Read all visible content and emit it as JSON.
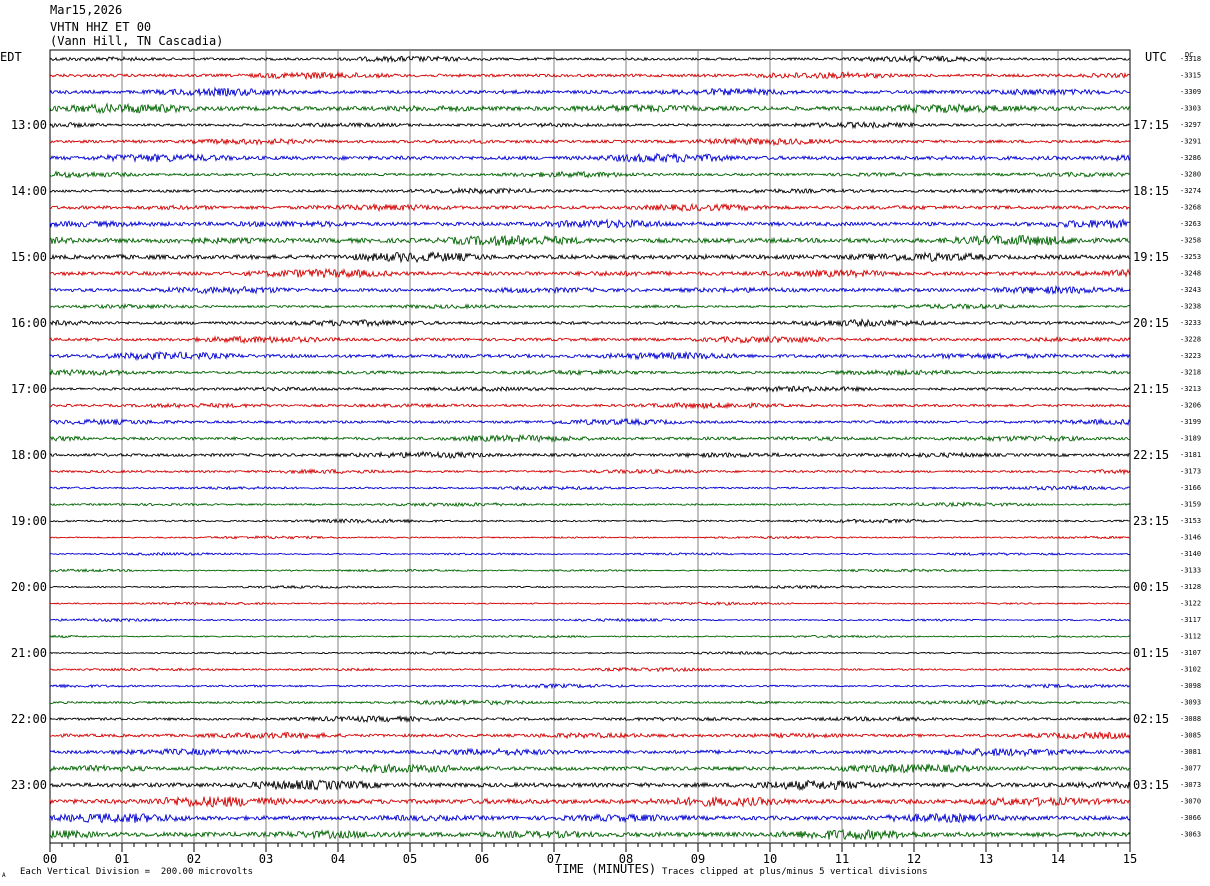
{
  "header": {
    "date": "Mar15,2026",
    "station": "VHTN HHZ ET 00",
    "location": "(Vann Hill, TN Cascadia)"
  },
  "left_zone_label": "EDT",
  "right_zone_label": "UTC",
  "dc_label": "DC",
  "footer": {
    "scale_note": "Each Vertical Division =  200.00 microvolts",
    "clip_note": "Traces clipped at plus/minus 5 vertical divisions",
    "corner_mark": "A"
  },
  "colors": {
    "trace_cycle": [
      "#000000",
      "#d40000",
      "#0000d4",
      "#006400"
    ],
    "grid": "#808080"
  },
  "chart_data": {
    "type": "line",
    "title": "",
    "xlabel": "TIME (MINUTES)",
    "ylabel": "",
    "xlim": [
      0,
      15
    ],
    "x_ticks": [
      "00",
      "01",
      "02",
      "03",
      "04",
      "05",
      "06",
      "07",
      "08",
      "09",
      "10",
      "11",
      "12",
      "13",
      "14",
      "15"
    ],
    "row_count": 48,
    "rows_per_hour": 4,
    "left_hour_labels": [
      "13:00",
      "14:00",
      "15:00",
      "16:00",
      "17:00",
      "18:00",
      "19:00",
      "20:00",
      "21:00",
      "22:00",
      "23:00"
    ],
    "right_hour_labels": [
      "17:15",
      "18:15",
      "19:15",
      "20:15",
      "21:15",
      "22:15",
      "23:15",
      "00:15",
      "01:15",
      "02:15",
      "03:15"
    ],
    "dc_offsets": [
      "-3318",
      "-3315",
      "-3309",
      "-3303",
      "-3297",
      "-3291",
      "-3286",
      "-3280",
      "-3274",
      "-3268",
      "-3263",
      "-3258",
      "-3253",
      "-3248",
      "-3243",
      "-3238",
      "-3233",
      "-3228",
      "-3223",
      "-3218",
      "-3213",
      "-3206",
      "-3199",
      "-3189",
      "-3181",
      "-3173",
      "-3166",
      "-3159",
      "-3153",
      "-3146",
      "-3140",
      "-3133",
      "-3128",
      "-3122",
      "-3117",
      "-3112",
      "-3107",
      "-3102",
      "-3098",
      "-3093",
      "-3088",
      "-3085",
      "-3081",
      "-3077",
      "-3073",
      "-3070",
      "-3066",
      "-3063"
    ],
    "trace_amplitude": [
      1.2,
      1.4,
      1.6,
      2.0,
      1.2,
      1.4,
      1.8,
      1.2,
      1.2,
      1.6,
      1.8,
      2.2,
      2.0,
      1.8,
      1.6,
      1.0,
      1.4,
      1.4,
      1.6,
      1.2,
      1.2,
      1.2,
      1.2,
      1.4,
      1.4,
      1.0,
      0.8,
      0.8,
      0.8,
      0.6,
      0.6,
      0.6,
      0.6,
      0.6,
      0.6,
      0.6,
      0.6,
      0.8,
      0.8,
      1.0,
      1.2,
      1.4,
      1.6,
      1.8,
      2.0,
      2.2,
      2.0,
      2.2
    ]
  }
}
